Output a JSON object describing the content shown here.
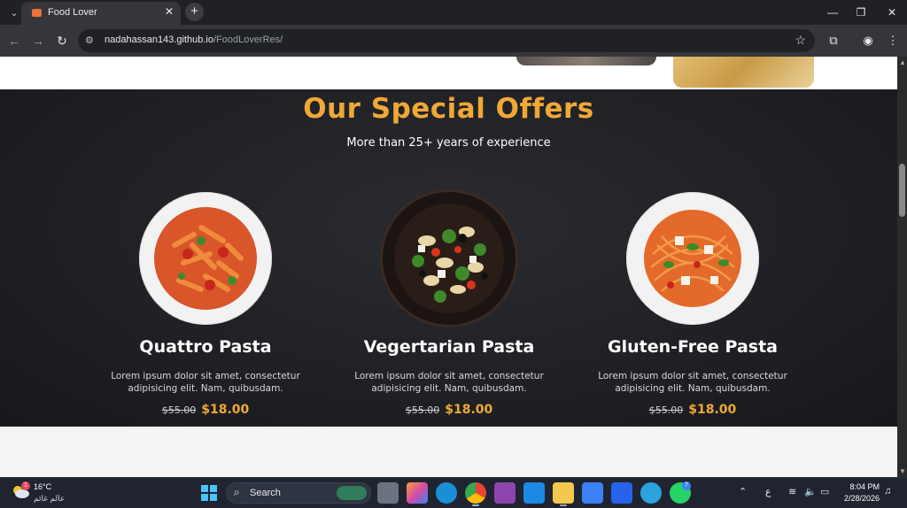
{
  "browser": {
    "tab_title": "Food Lover",
    "url_host": "nadahassan143.github.io",
    "url_path": "/FoodLoverRes/"
  },
  "offers": {
    "title": "Our Special Offers",
    "subtitle": "More than 25+ years of experience",
    "cards": [
      {
        "name": "Quattro Pasta",
        "description": "Lorem ipsum dolor sit amet, consectetur adipisicing elit. Nam, quibusdam.",
        "old_price": "$55.00",
        "new_price": "$18.00"
      },
      {
        "name": "Vegertarian Pasta",
        "description": "Lorem ipsum dolor sit amet, consectetur adipisicing elit. Nam, quibusdam.",
        "old_price": "$55.00",
        "new_price": "$18.00"
      },
      {
        "name": "Gluten-Free Pasta",
        "description": "Lorem ipsum dolor sit amet, consectetur adipisicing elit. Nam, quibusdam.",
        "old_price": "$55.00",
        "new_price": "$18.00"
      }
    ]
  },
  "taskbar": {
    "weather_temp": "16°C",
    "weather_desc": "عالم غائم",
    "weather_badge": "1",
    "search_label": "Search",
    "whatsapp_badge": "7",
    "input_lang": "ع",
    "time": "8:04 PM",
    "date": "2/28/2026"
  },
  "colors": {
    "accent": "#f0a836",
    "section_bg": "#1d1e22",
    "chrome_bg": "#202124"
  }
}
